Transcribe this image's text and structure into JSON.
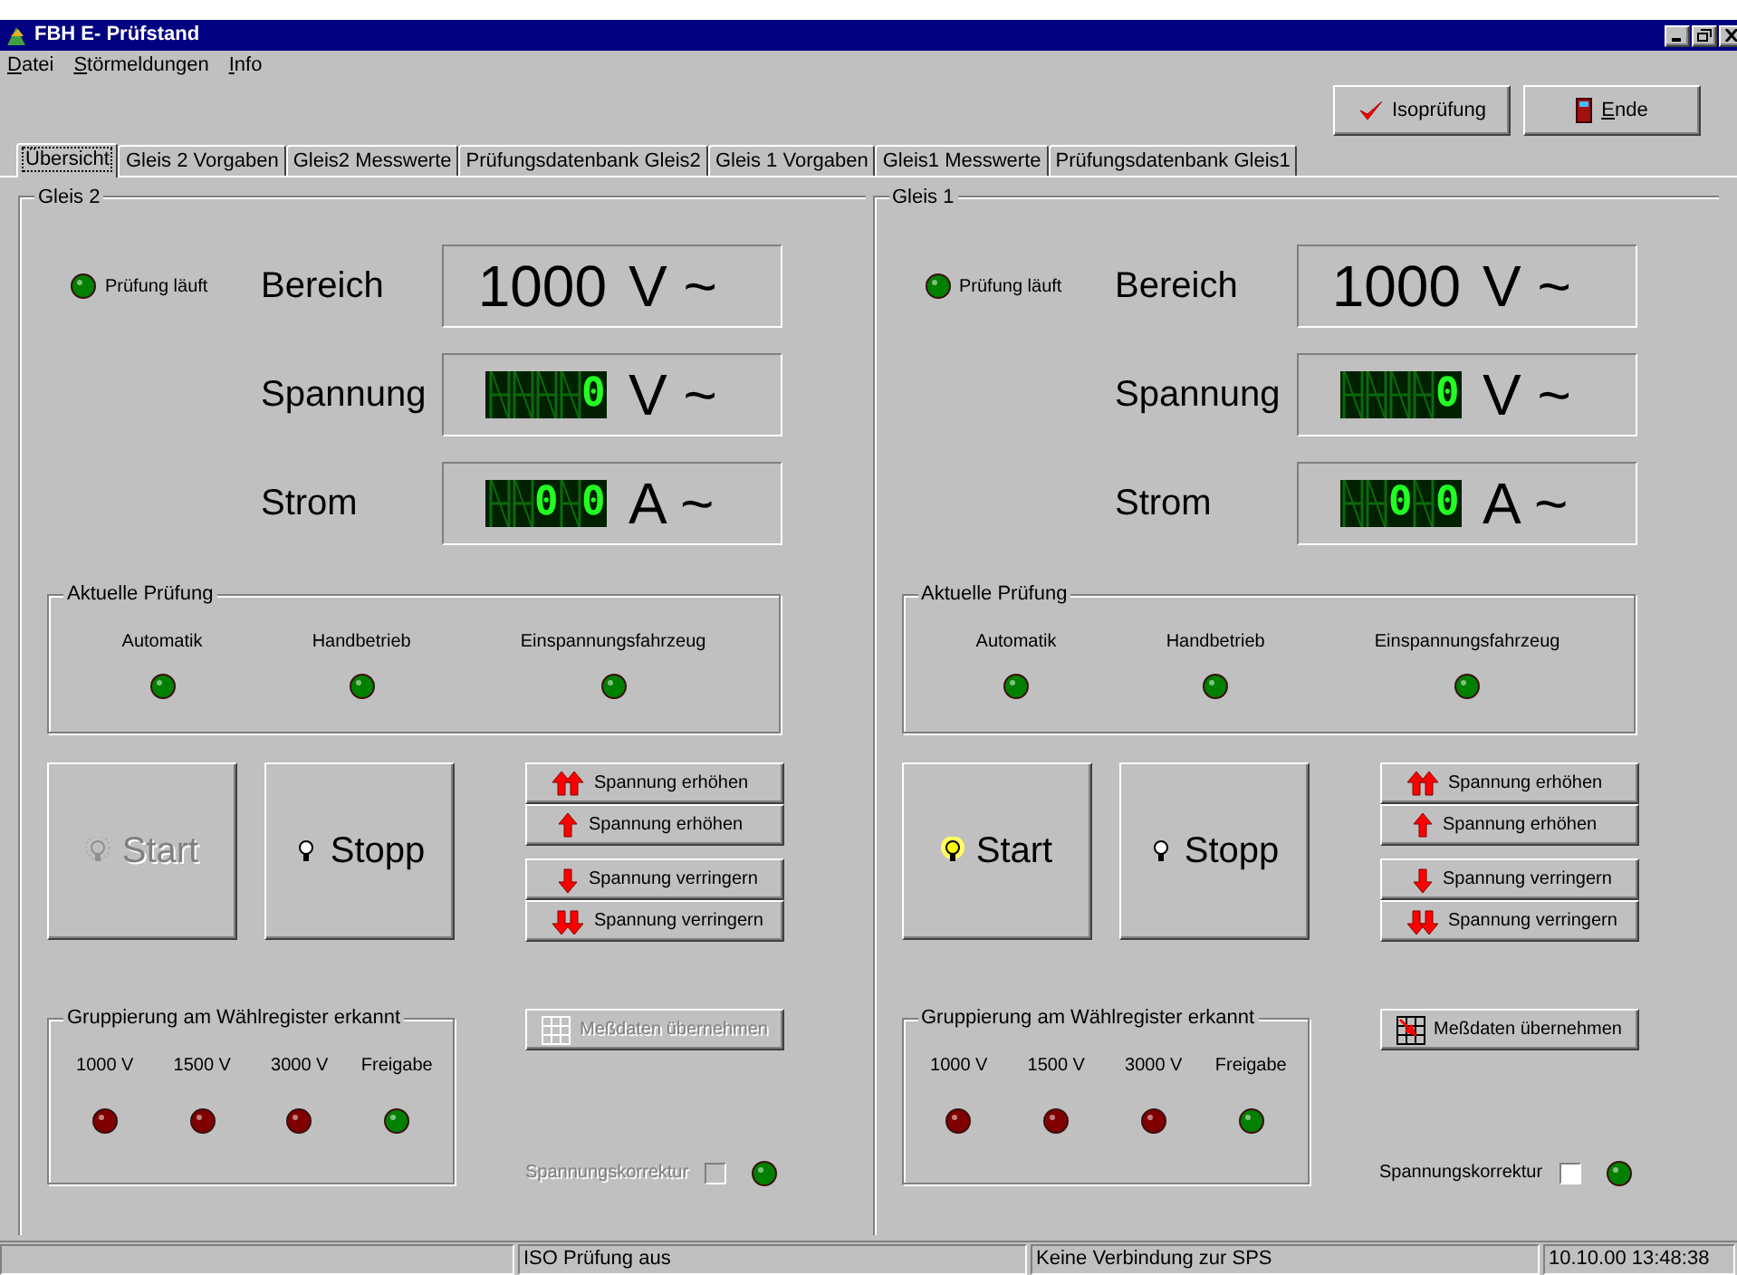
{
  "window": {
    "title": "FBH E- Prüfstand"
  },
  "menu": [
    "Datei",
    "Störmeldungen",
    "Info"
  ],
  "toolbar": [
    {
      "kind": "check",
      "label": "Isoprüfung"
    },
    {
      "kind": "exit",
      "label": "Ende"
    }
  ],
  "tabs": [
    {
      "label": "Übersicht",
      "selected": true
    },
    {
      "label": "Gleis 2 Vorgaben",
      "selected": false
    },
    {
      "label": "Gleis2 Messwerte",
      "selected": false
    },
    {
      "label": "Prüfungsdatenbank Gleis2",
      "selected": false
    },
    {
      "label": "Gleis 1 Vorgaben",
      "selected": false
    },
    {
      "label": "Gleis1 Messwerte",
      "selected": false
    },
    {
      "label": "Prüfungsdatenbank Gleis1",
      "selected": false
    }
  ],
  "panels": [
    {
      "title": "Gleis 2",
      "running": {
        "label": "Prüfung läuft",
        "color": "#008000"
      },
      "readings": [
        {
          "label": "Bereich",
          "kind": "text",
          "value": "1000",
          "unit": "V ~"
        },
        {
          "label": "Spannung",
          "kind": "lcd",
          "cells": [
            {
              "lit": false
            },
            {
              "lit": false
            },
            {
              "lit": false
            },
            {
              "lit": false
            },
            {
              "lit": true,
              "char": "0"
            }
          ],
          "unit": "V ~"
        },
        {
          "label": "Strom",
          "kind": "lcd",
          "cells": [
            {
              "lit": false
            },
            {
              "lit": false
            },
            {
              "lit": true,
              "char": "0"
            },
            {
              "lit": false
            },
            {
              "lit": true,
              "char": "0"
            }
          ],
          "unit": "A ~"
        }
      ],
      "current_test": {
        "title": "Aktuelle Prüfung",
        "items": [
          {
            "label": "Automatik",
            "color": "#008000"
          },
          {
            "label": "Handbetrieb",
            "color": "#008000"
          },
          {
            "label": "Einspannungsfahrzeug",
            "color": "#008000"
          }
        ]
      },
      "start": {
        "label": "Start",
        "disabled": true,
        "lamp_lit": false
      },
      "stop": {
        "label": "Stopp",
        "disabled": false
      },
      "voltage_buttons": [
        {
          "kind": "up2",
          "label": "Spannung erhöhen"
        },
        {
          "kind": "up1",
          "label": "Spannung erhöhen"
        },
        {
          "kind": "down1",
          "label": "Spannung verringern"
        },
        {
          "kind": "down2",
          "label": "Spannung verringern"
        }
      ],
      "grouping": {
        "title": "Gruppierung am Wählregister erkannt",
        "items": [
          {
            "label": "1000 V",
            "color": "#800000"
          },
          {
            "label": "1500 V",
            "color": "#800000"
          },
          {
            "label": "3000 V",
            "color": "#800000"
          },
          {
            "label": "Freigabe",
            "color": "#008000"
          }
        ]
      },
      "take_data": {
        "label": "Meßdaten übernehmen",
        "disabled": true
      },
      "correction": {
        "label": "Spannungskorrektur",
        "disabled": true,
        "checked": false,
        "color": "#008000"
      }
    },
    {
      "title": "Gleis 1",
      "running": {
        "label": "Prüfung läuft",
        "color": "#008000"
      },
      "readings": [
        {
          "label": "Bereich",
          "kind": "text",
          "value": "1000",
          "unit": "V ~"
        },
        {
          "label": "Spannung",
          "kind": "lcd",
          "cells": [
            {
              "lit": false
            },
            {
              "lit": false
            },
            {
              "lit": false
            },
            {
              "lit": false
            },
            {
              "lit": true,
              "char": "0"
            }
          ],
          "unit": "V ~"
        },
        {
          "label": "Strom",
          "kind": "lcd",
          "cells": [
            {
              "lit": false
            },
            {
              "lit": false
            },
            {
              "lit": true,
              "char": "0"
            },
            {
              "lit": false
            },
            {
              "lit": true,
              "char": "0"
            }
          ],
          "unit": "A ~"
        }
      ],
      "current_test": {
        "title": "Aktuelle Prüfung",
        "items": [
          {
            "label": "Automatik",
            "color": "#008000"
          },
          {
            "label": "Handbetrieb",
            "color": "#008000"
          },
          {
            "label": "Einspannungsfahrzeug",
            "color": "#008000"
          }
        ]
      },
      "start": {
        "label": "Start",
        "disabled": false,
        "lamp_lit": true
      },
      "stop": {
        "label": "Stopp",
        "disabled": false
      },
      "voltage_buttons": [
        {
          "kind": "up2",
          "label": "Spannung erhöhen"
        },
        {
          "kind": "up1",
          "label": "Spannung erhöhen"
        },
        {
          "kind": "down1",
          "label": "Spannung verringern"
        },
        {
          "kind": "down2",
          "label": "Spannung verringern"
        }
      ],
      "grouping": {
        "title": "Gruppierung am Wählregister erkannt",
        "items": [
          {
            "label": "1000 V",
            "color": "#800000"
          },
          {
            "label": "1500 V",
            "color": "#800000"
          },
          {
            "label": "3000 V",
            "color": "#800000"
          },
          {
            "label": "Freigabe",
            "color": "#008000"
          }
        ]
      },
      "take_data": {
        "label": "Meßdaten übernehmen",
        "disabled": false
      },
      "correction": {
        "label": "Spannungskorrektur",
        "disabled": false,
        "checked": false,
        "color": "#008000"
      }
    }
  ],
  "status_bar": [
    "ISO Prüfung aus",
    "Keine Verbindung zur SPS",
    "10.10.00 13:48:38"
  ]
}
